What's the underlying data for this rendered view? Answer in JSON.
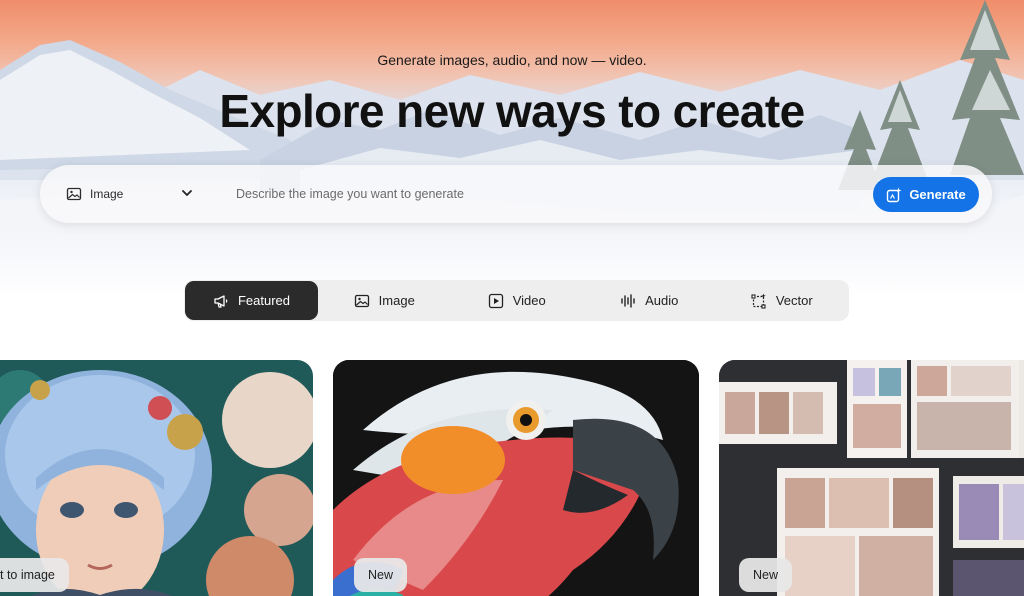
{
  "hero": {
    "tagline": "Generate images, audio, and now — video.",
    "headline": "Explore new ways to create"
  },
  "prompt_bar": {
    "type_label": "Image",
    "placeholder": "Describe the image you want to generate",
    "value": "",
    "generate_label": "Generate"
  },
  "tabs": [
    {
      "label": "Featured",
      "icon": "megaphone-icon",
      "active": true
    },
    {
      "label": "Image",
      "icon": "image-icon",
      "active": false
    },
    {
      "label": "Video",
      "icon": "play-icon",
      "active": false
    },
    {
      "label": "Audio",
      "icon": "waveform-icon",
      "active": false
    },
    {
      "label": "Vector",
      "icon": "vector-icon",
      "active": false
    }
  ],
  "cards": [
    {
      "badge": "t to image"
    },
    {
      "badge": "New"
    },
    {
      "badge": "New"
    }
  ],
  "colors": {
    "accent": "#1473e6",
    "active_tab": "#2b2b2b",
    "tab_bar": "#eeeeee"
  }
}
